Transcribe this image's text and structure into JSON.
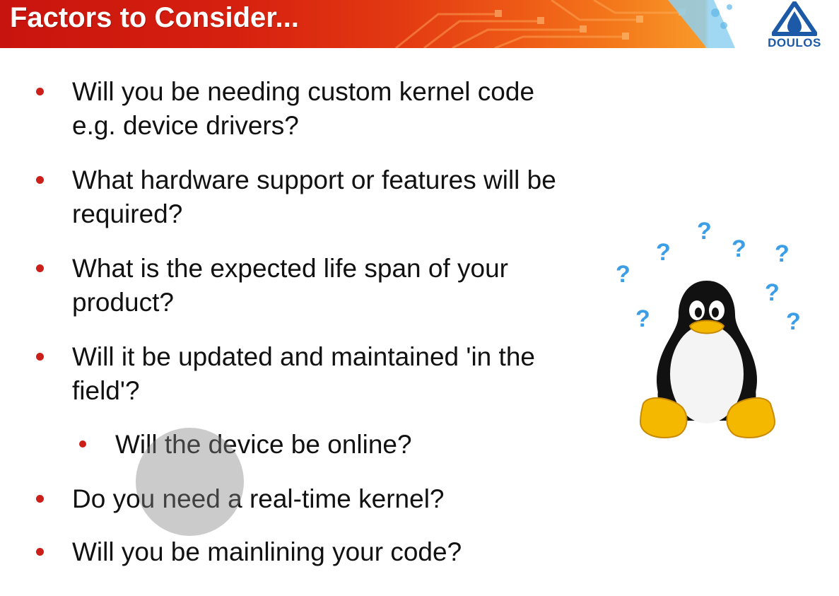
{
  "slide": {
    "title": "Factors to Consider...",
    "logo_text": "DOULOS",
    "bullets": [
      {
        "line1": "Will you be needing custom kernel code",
        "line2": "e.g. device drivers?"
      },
      {
        "line1": "What hardware support or features will be",
        "line2": "required?"
      },
      {
        "line1": "What is the expected life span of your",
        "line2": "product?"
      },
      {
        "line1": "Will it be updated and maintained 'in the",
        "line2": "field'?"
      },
      {
        "line1": "Will the device be online?"
      },
      {
        "line1": "Do you need a real-time kernel?"
      },
      {
        "line1": "Will you be mainlining your code?"
      }
    ],
    "question_mark": "?"
  },
  "colors": {
    "header_red": "#c8140e",
    "header_orange": "#f47a1c",
    "bullet_red": "#cc1f1a",
    "logo_blue": "#1c5aa8",
    "question_blue": "#3b9ee6",
    "penguin_yellow": "#f5b800"
  },
  "icons": [
    "doulos-logo-icon",
    "tux-penguin-icon",
    "question-mark-icon",
    "cursor-highlight"
  ]
}
